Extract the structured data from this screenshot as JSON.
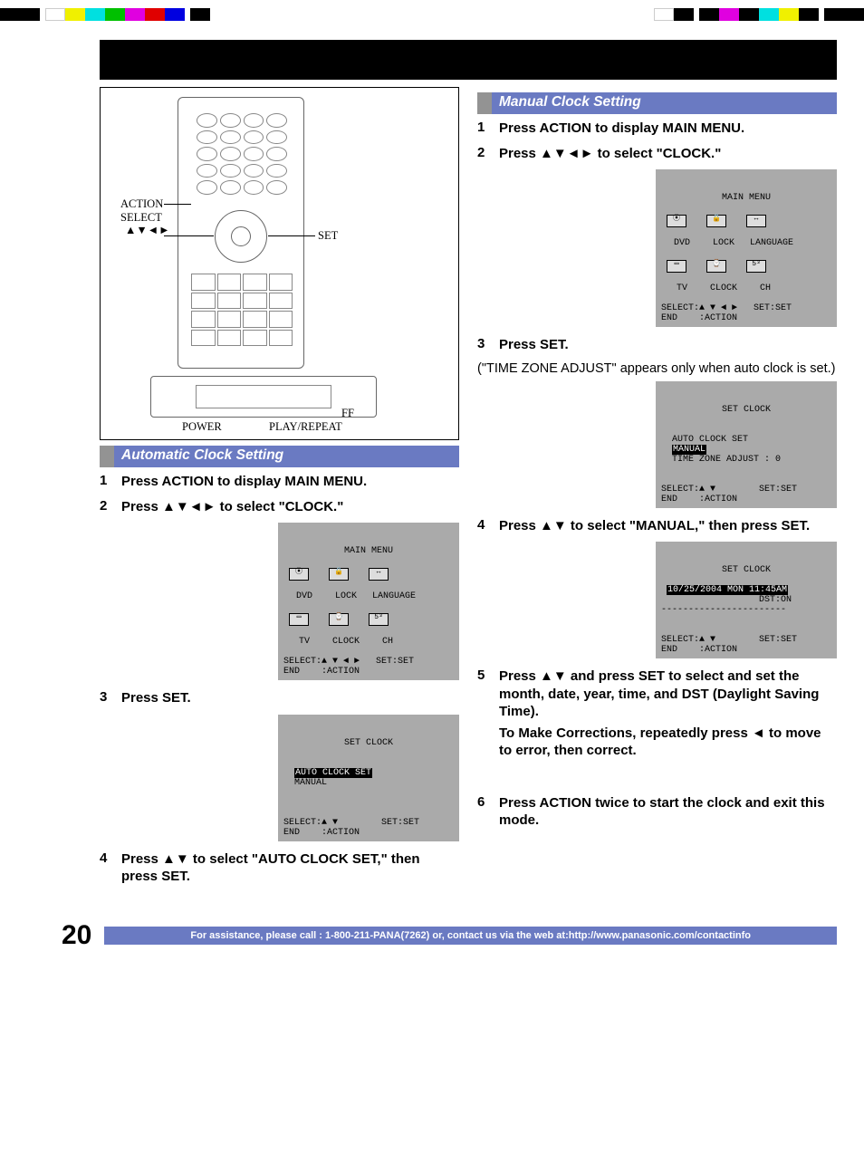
{
  "topbar_note": "color calibration bars",
  "remote_labels": {
    "action": "ACTION",
    "select_line1": "SELECT",
    "select_line2": "▲▼◄►",
    "set": "SET",
    "power": "POWER",
    "ff": "FF",
    "play": "PLAY/REPEAT"
  },
  "sections": {
    "auto": {
      "title": "Automatic Clock Setting",
      "steps": [
        {
          "n": "1",
          "t": "Press ACTION to display MAIN MENU."
        },
        {
          "n": "2",
          "t": "Press ▲▼◄► to select \"CLOCK.\""
        },
        {
          "n": "3",
          "t": "Press SET."
        },
        {
          "n": "4",
          "t": "Press ▲▼ to select \"AUTO CLOCK SET,\" then press SET."
        }
      ],
      "osd_main": {
        "title": "MAIN MENU",
        "row1": [
          "DVD",
          "LOCK",
          "LANGUAGE"
        ],
        "row2": [
          "TV",
          "CLOCK",
          "CH"
        ],
        "footer1": "SELECT:▲ ▼ ◄ ►   SET:SET",
        "footer2": "END    :ACTION"
      },
      "osd_clock": {
        "title": "SET CLOCK",
        "line1": "AUTO CLOCK SET",
        "line2": "MANUAL",
        "footer1": "SELECT:▲ ▼        SET:SET",
        "footer2": "END    :ACTION"
      }
    },
    "manual": {
      "title": "Manual Clock Setting",
      "steps": [
        {
          "n": "1",
          "t": "Press ACTION to display MAIN MENU."
        },
        {
          "n": "2",
          "t": "Press ▲▼◄► to select \"CLOCK.\""
        },
        {
          "n": "3",
          "t": "Press SET."
        },
        {
          "n": "3note",
          "t": "(\"TIME ZONE ADJUST\" appears only when auto clock is set.)"
        },
        {
          "n": "4",
          "t": "Press ▲▼ to select \"MANUAL,\" then press SET."
        },
        {
          "n": "5",
          "t": "Press ▲▼ and press SET to select and set the month, date, year, time, and DST (Daylight Saving Time)."
        },
        {
          "n": "5b",
          "t": "To Make Corrections, repeatedly press ◄ to move to error, then correct."
        },
        {
          "n": "6",
          "t": "Press ACTION twice to start the clock and exit this mode."
        }
      ],
      "osd_main": {
        "title": "MAIN MENU",
        "row1": [
          "DVD",
          "LOCK",
          "LANGUAGE"
        ],
        "row2": [
          "TV",
          "CLOCK",
          "CH"
        ],
        "footer1": "SELECT:▲ ▼ ◄ ►   SET:SET",
        "footer2": "END    :ACTION"
      },
      "osd_clock1": {
        "title": "SET CLOCK",
        "line1": "AUTO CLOCK SET",
        "line2": "MANUAL",
        "line3": "TIME ZONE ADJUST : 0",
        "footer1": "SELECT:▲ ▼        SET:SET",
        "footer2": "END    :ACTION"
      },
      "osd_clock2": {
        "title": "SET CLOCK",
        "line1": "10/25/2004 MON 11:45AM",
        "line2": "DST:ON",
        "footer1": "SELECT:▲ ▼        SET:SET",
        "footer2": "END    :ACTION"
      }
    }
  },
  "page_number": "20",
  "footer": "For assistance, please call : 1-800-211-PANA(7262) or, contact us via the web at:http://www.panasonic.com/contactinfo"
}
